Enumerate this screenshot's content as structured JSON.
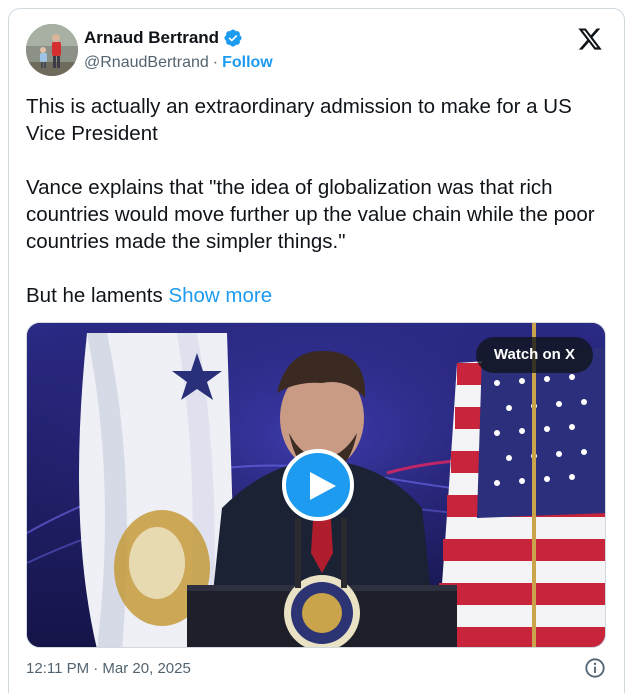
{
  "author": {
    "display_name": "Arnaud Bertrand",
    "handle": "@RnaudBertrand",
    "separator": "·",
    "follow_label": "Follow",
    "verified_color": "#1d9bf0"
  },
  "tweet": {
    "paragraph_1": "This is actually an extraordinary admission to make for a US Vice President",
    "paragraph_2": "Vance explains that \"the idea of globalization was that rich countries would move further up the value chain while the poor countries made the simpler things.\"",
    "paragraph_3": "But he laments",
    "show_more_label": "Show more"
  },
  "media": {
    "watch_label": "Watch on X",
    "play_icon": "play-icon"
  },
  "footer": {
    "timestamp": "12:11 PM · Mar 20, 2025",
    "info_icon": "info-icon"
  },
  "colors": {
    "accent": "#1d9bf0",
    "text": "#0f1419",
    "muted": "#536471",
    "border": "#cfd9de"
  }
}
